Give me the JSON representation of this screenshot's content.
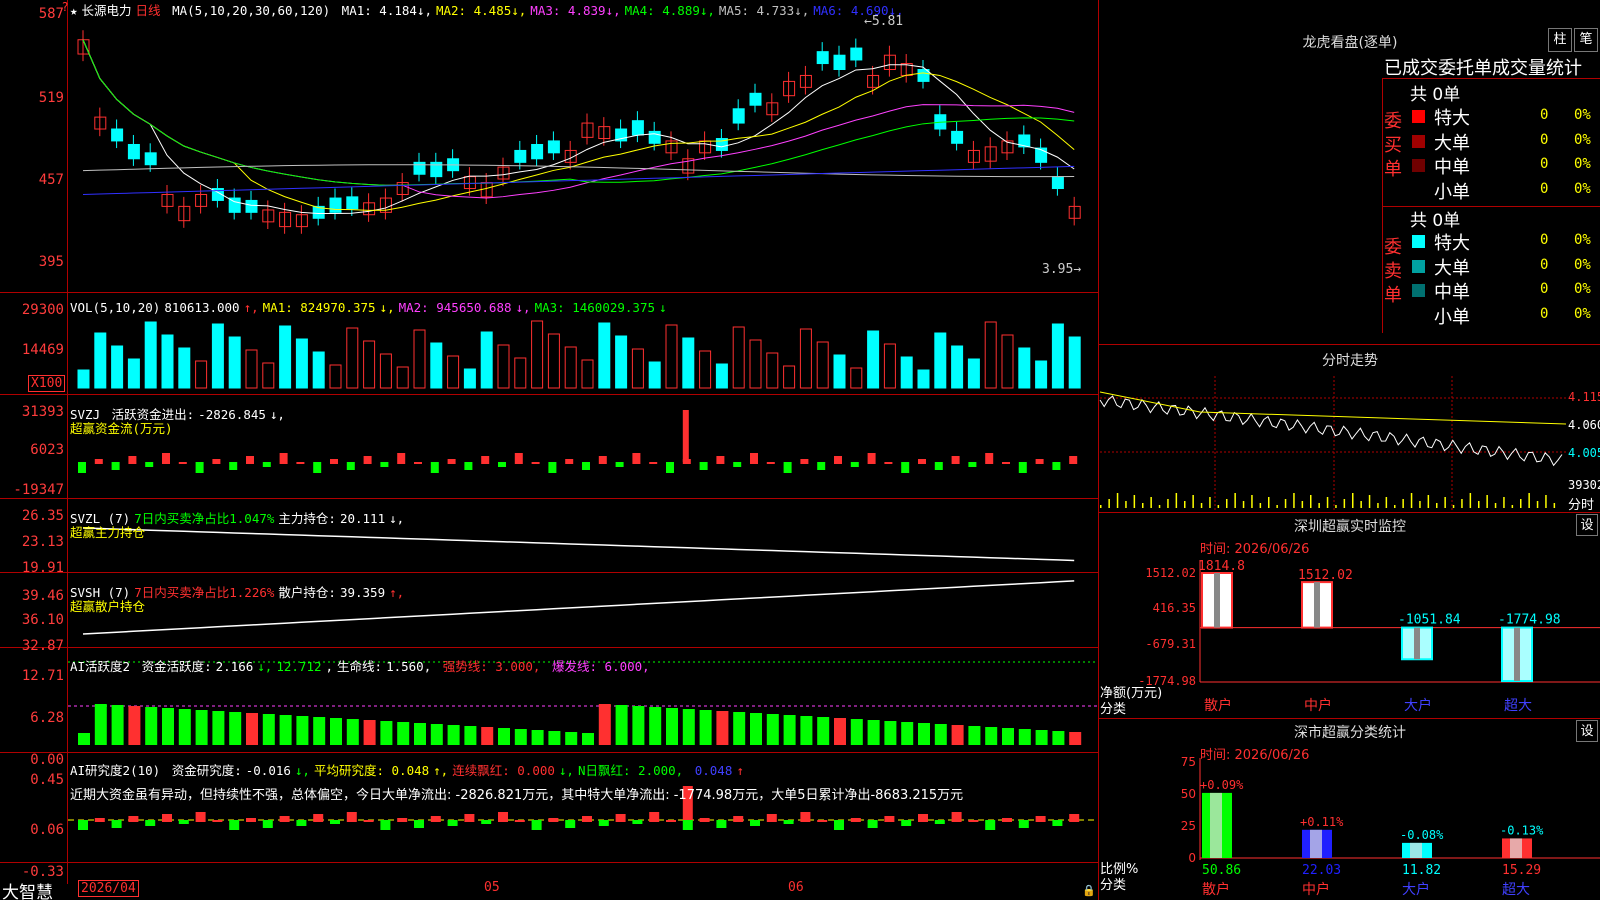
{
  "stock": {
    "name": "长源电力",
    "period": "日线"
  },
  "main_chart": {
    "ma_prefix": "MA(5,10,20,30,60,120)",
    "mas": [
      {
        "label": "MA1:",
        "value": "4.184",
        "arrow": "↓",
        "color": "#ffffff"
      },
      {
        "label": "MA2:",
        "value": "4.485",
        "arrow": "↓",
        "color": "#ffff00"
      },
      {
        "label": "MA3:",
        "value": "4.839",
        "arrow": "↓",
        "color": "#ff40ff"
      },
      {
        "label": "MA4:",
        "value": "4.889",
        "arrow": "↓",
        "color": "#00ff00"
      },
      {
        "label": "MA5:",
        "value": "4.733",
        "arrow": "↓",
        "color": "#c0c0c0"
      },
      {
        "label": "MA6:",
        "value": "4.690",
        "arrow": "↓",
        "color": "#3030ff"
      }
    ],
    "y_ticks": [
      "587",
      "519",
      "457",
      "395"
    ],
    "high_mark": "5.81",
    "low_mark": "3.95"
  },
  "vol_panel": {
    "prefix": "VOL(5,10,20)",
    "value": "810613.000",
    "ma1": "824970.375",
    "ma2": "945650.688",
    "ma3": "1460029.375",
    "y_ticks": [
      "29300",
      "14469"
    ],
    "unit": "X100"
  },
  "svzj_panel": {
    "prefix": "SVZJ",
    "label": "活跃资金进出:",
    "value": "-2826.845",
    "subtitle": "超赢资金流(万元)",
    "y_ticks": [
      "31393",
      "6023",
      "-19347"
    ]
  },
  "svzl_panel": {
    "prefix": "SVZL (7)",
    "ratio_label": "7日内买卖净占比1.047%",
    "hold_label": "主力持仓:",
    "hold_value": "20.111",
    "subtitle": "超赢主力持仓",
    "y_ticks": [
      "26.35",
      "23.13",
      "19.91"
    ]
  },
  "svsh_panel": {
    "prefix": "SVSH (7)",
    "ratio_label": "7日内买卖净占比1.226%",
    "hold_label": "散户持仓:",
    "hold_value": "39.359",
    "subtitle": "超赢散户持仓",
    "y_ticks": [
      "39.46",
      "36.10",
      "32.87"
    ]
  },
  "ai_active_panel": {
    "prefix": "AI活跃度2",
    "label": "资金活跃度:",
    "value": "2.166",
    "v2": "12.712",
    "life_label": "生命线:",
    "life_value": "1.560,",
    "strong": "强势线: 3.000,",
    "burst": "爆发线: 6.000,",
    "y_ticks": [
      "12.71",
      "6.28",
      "0.00"
    ]
  },
  "ai_research_panel": {
    "prefix": "AI研究度2(10)",
    "label": "资金研究度:",
    "value": "-0.016",
    "avg": "平均研究度: 0.048",
    "red": "连续飘红: 0.000",
    "nred": "N日飘红: 2.000,",
    "last": "0.048",
    "comment": "近期大资金虽有异动，但持续性不强，总体偏空，今日大单净流出: -2826.821万元，其中特大单净流出: -1774.98万元，大单5日累计净出-8683.215万元",
    "y_ticks": [
      "0.45",
      "0.06",
      "-0.33"
    ]
  },
  "x_axis": {
    "dates": [
      "2026/04",
      "05",
      "06"
    ]
  },
  "bottom_brand": "大智慧",
  "dragon_tiger": {
    "title": "龙虎看盘(逐单)",
    "btn1": "柱",
    "btn2": "笔",
    "header": "已成交委托单成交量统计",
    "buy_side": "委买单",
    "sell_side": "委卖单",
    "buy_total": "共 0单",
    "sell_total": "共 0单",
    "buy_rows": [
      {
        "label": "特大",
        "count": "0",
        "pct": "0%",
        "color": "#ff0000"
      },
      {
        "label": "大单",
        "count": "0",
        "pct": "0%",
        "color": "#a00000"
      },
      {
        "label": "中单",
        "count": "0",
        "pct": "0%",
        "color": "#700000"
      },
      {
        "label": "小单",
        "count": "0",
        "pct": "0%",
        "color": ""
      }
    ],
    "sell_rows": [
      {
        "label": "特大",
        "count": "0",
        "pct": "0%",
        "color": "#00ffff"
      },
      {
        "label": "大单",
        "count": "0",
        "pct": "0%",
        "color": "#00a0a0"
      },
      {
        "label": "中单",
        "count": "0",
        "pct": "0%",
        "color": "#007070"
      },
      {
        "label": "小单",
        "count": "0",
        "pct": "0%",
        "color": ""
      }
    ]
  },
  "intraday": {
    "title": "分时走势",
    "y_ticks": [
      "4.115",
      "4.060",
      "4.005"
    ],
    "vol_label": "39302",
    "unit": "分时"
  },
  "sz_monitor": {
    "title": "深圳超赢实时监控",
    "btn": "设",
    "time": "时间: 2026/06/26",
    "y_ticks": [
      "1512.02",
      "416.35",
      "-679.31",
      "-1774.98"
    ],
    "side_label1": "净额(万元)",
    "side_label2": "分类",
    "bars": [
      {
        "cat": "散户",
        "value": 1814.8,
        "label": "1814.8"
      },
      {
        "cat": "中户",
        "value": 1512.02,
        "label": "1512.02"
      },
      {
        "cat": "大户",
        "value": -1051.84,
        "label": "-1051.84"
      },
      {
        "cat": "超大",
        "value": -1774.98,
        "label": "-1774.98"
      }
    ]
  },
  "sz_category": {
    "title": "深市超赢分类统计",
    "btn": "设",
    "time": "时间: 2026/06/26",
    "y_ticks": [
      "75",
      "50",
      "25",
      "0"
    ],
    "side_label1": "比例%",
    "side_label2": "分类",
    "bars": [
      {
        "cat": "散户",
        "value": 50.86,
        "delta": "+0.09%",
        "color": "#00ff00"
      },
      {
        "cat": "中户",
        "value": 22.03,
        "delta": "+0.11%",
        "color": "#2020ff"
      },
      {
        "cat": "大户",
        "value": 11.82,
        "delta": "-0.08%",
        "color": "#00ffff"
      },
      {
        "cat": "超大",
        "value": 15.29,
        "delta": "-0.13%",
        "color": "#ff3030"
      }
    ]
  }
}
